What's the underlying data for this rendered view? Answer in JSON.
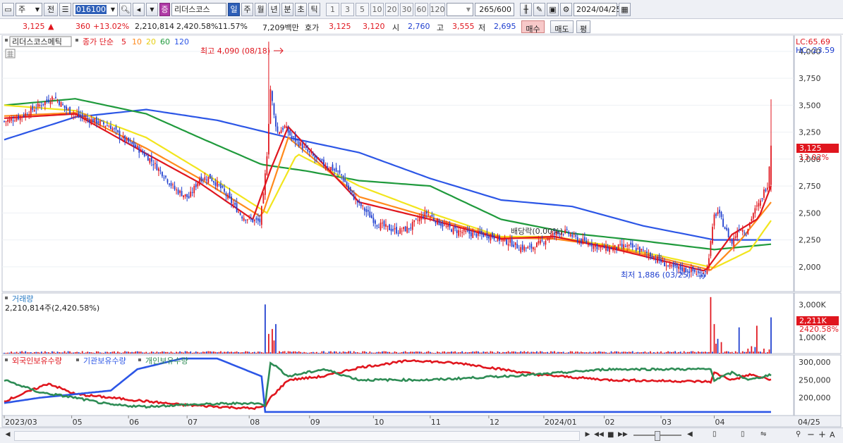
{
  "toolbar": {
    "type_label": "주",
    "prev_label": "전",
    "code": "016100",
    "name": "리더스코스",
    "periods": [
      "일",
      "주",
      "월",
      "년",
      "분",
      "초",
      "틱"
    ],
    "intervals": [
      "1",
      "3",
      "5",
      "10",
      "20",
      "30",
      "60",
      "120"
    ],
    "count": "265",
    "count_total": "/600",
    "date": "2024/04/25"
  },
  "quote": {
    "price": "3,125",
    "arrow": "▲",
    "change": "360",
    "change_pct": "+13.02%",
    "volume": "2,210,814",
    "volume_pct": "2,420.58%",
    "turnover": "11.57%",
    "amount": "7,209백만",
    "hoga_label": "호가",
    "ask": "3,125",
    "bid": "3,120",
    "open_label": "시",
    "open": "2,760",
    "high_label": "고",
    "high": "3,555",
    "low_label": "저",
    "low": "2,695",
    "buy_label": "매수",
    "sell_label": "매도",
    "eval_label": "평"
  },
  "colors": {
    "up": "#e0161e",
    "down": "#1f3fcf",
    "ma5": "#e0161e",
    "ma10": "#ff8a1c",
    "ma20": "#f2e51d",
    "ma60": "#1f9a3c",
    "ma120": "#2c56e6"
  },
  "legend": {
    "stock_name": "리더스코스메틱",
    "ma_label": "종가 단순",
    "ma_periods": [
      "5",
      "10",
      "20",
      "60",
      "120"
    ]
  },
  "price_panel": {
    "lc": "LC:65.69",
    "hc": "HC:-23.59",
    "max_label": "최고 4,090 (08/18)",
    "min_label": "최저 1,886 (03/25)",
    "dividend_label": "배당락(0.00%)",
    "current_label": "3,125",
    "current_pct": "13.02%"
  },
  "volume_panel": {
    "title": "거래량",
    "subtitle": "2,210,814주(2,420.58%)",
    "current_label": "2,211K",
    "current_pct": "2420.58%"
  },
  "holdings_panel": {
    "series_labels": [
      "외국인보유수량",
      "기관보유수량",
      "개인보유수량"
    ]
  },
  "chart_data": [
    {
      "type": "candlestick",
      "title": "리더스코스메틱",
      "ylim": [
        1770,
        4150
      ],
      "y_ticks": [
        2000,
        2250,
        2500,
        2750,
        3000,
        3250,
        3500,
        3750,
        4000
      ],
      "y_tick_labels": [
        "2,000",
        "2,250",
        "2,500",
        "2,750",
        "3,000",
        "3,250",
        "3,500",
        "3,750",
        "4,000"
      ],
      "x_tick_labels": [
        "2023/03",
        "05",
        "06",
        "07",
        "08",
        "09",
        "10",
        "11",
        "12",
        "2024/01",
        "02",
        "03",
        "04",
        "04/25"
      ],
      "annotations": {
        "high": {
          "value": 4090,
          "date": "08/18"
        },
        "low": {
          "value": 1886,
          "date": "03/25"
        },
        "last": {
          "value": 3125,
          "change_pct": 13.02
        }
      },
      "close_path": [
        [
          0,
          3350
        ],
        [
          10,
          3400
        ],
        [
          20,
          3500
        ],
        [
          28,
          3580
        ],
        [
          35,
          3460
        ],
        [
          45,
          3380
        ],
        [
          52,
          3350
        ],
        [
          60,
          3300
        ],
        [
          66,
          3200
        ],
        [
          75,
          3100
        ],
        [
          82,
          3000
        ],
        [
          90,
          2850
        ],
        [
          96,
          2720
        ],
        [
          104,
          2640
        ],
        [
          110,
          2820
        ],
        [
          116,
          2830
        ],
        [
          122,
          2730
        ],
        [
          128,
          2600
        ],
        [
          134,
          2470
        ],
        [
          140,
          2430
        ],
        [
          144,
          2420
        ],
        [
          146,
          2650
        ],
        [
          148,
          3050
        ],
        [
          150,
          3650
        ],
        [
          152,
          3400
        ],
        [
          154,
          3250
        ],
        [
          158,
          3300
        ],
        [
          162,
          3200
        ],
        [
          166,
          3150
        ],
        [
          172,
          3050
        ],
        [
          178,
          2970
        ],
        [
          184,
          2920
        ],
        [
          190,
          2850
        ],
        [
          194,
          2720
        ],
        [
          198,
          2620
        ],
        [
          204,
          2510
        ],
        [
          210,
          2400
        ],
        [
          216,
          2360
        ],
        [
          222,
          2330
        ],
        [
          228,
          2360
        ],
        [
          234,
          2450
        ],
        [
          238,
          2500
        ],
        [
          244,
          2420
        ],
        [
          250,
          2360
        ],
        [
          256,
          2330
        ],
        [
          262,
          2310
        ],
        [
          268,
          2300
        ],
        [
          274,
          2290
        ],
        [
          280,
          2250
        ],
        [
          286,
          2220
        ],
        [
          290,
          2180
        ],
        [
          296,
          2170
        ],
        [
          302,
          2220
        ],
        [
          308,
          2290
        ],
        [
          314,
          2330
        ],
        [
          318,
          2310
        ],
        [
          324,
          2240
        ],
        [
          330,
          2220
        ],
        [
          334,
          2190
        ],
        [
          340,
          2170
        ],
        [
          346,
          2180
        ],
        [
          350,
          2190
        ],
        [
          356,
          2170
        ],
        [
          360,
          2140
        ],
        [
          364,
          2110
        ],
        [
          368,
          2070
        ],
        [
          372,
          2030
        ],
        [
          376,
          1990
        ],
        [
          382,
          1980
        ],
        [
          388,
          1960
        ],
        [
          392,
          1930
        ],
        [
          396,
          1990
        ],
        [
          398,
          2220
        ],
        [
          400,
          2470
        ],
        [
          402,
          2510
        ],
        [
          406,
          2360
        ],
        [
          410,
          2220
        ],
        [
          414,
          2370
        ],
        [
          418,
          2320
        ],
        [
          422,
          2500
        ],
        [
          426,
          2600
        ],
        [
          428,
          2700
        ],
        [
          430,
          2765
        ],
        [
          432,
          3125
        ]
      ],
      "ma": {
        "5": [
          [
            0,
            3380
          ],
          [
            40,
            3420
          ],
          [
            80,
            3050
          ],
          [
            110,
            2780
          ],
          [
            140,
            2440
          ],
          [
            150,
            2900
          ],
          [
            160,
            3300
          ],
          [
            200,
            2600
          ],
          [
            240,
            2440
          ],
          [
            280,
            2260
          ],
          [
            310,
            2280
          ],
          [
            340,
            2180
          ],
          [
            370,
            2060
          ],
          [
            395,
            1960
          ],
          [
            410,
            2300
          ],
          [
            425,
            2450
          ],
          [
            432,
            2750
          ]
        ],
        "10": [
          [
            0,
            3400
          ],
          [
            40,
            3430
          ],
          [
            80,
            3100
          ],
          [
            110,
            2820
          ],
          [
            145,
            2460
          ],
          [
            160,
            3200
          ],
          [
            200,
            2650
          ],
          [
            240,
            2460
          ],
          [
            280,
            2270
          ],
          [
            310,
            2260
          ],
          [
            340,
            2190
          ],
          [
            370,
            2080
          ],
          [
            398,
            1970
          ],
          [
            415,
            2250
          ],
          [
            432,
            2600
          ]
        ],
        "20": [
          [
            0,
            3500
          ],
          [
            40,
            3450
          ],
          [
            80,
            3200
          ],
          [
            110,
            2900
          ],
          [
            148,
            2500
          ],
          [
            165,
            3050
          ],
          [
            200,
            2750
          ],
          [
            240,
            2500
          ],
          [
            280,
            2280
          ],
          [
            310,
            2280
          ],
          [
            340,
            2200
          ],
          [
            370,
            2100
          ],
          [
            400,
            1990
          ],
          [
            420,
            2150
          ],
          [
            432,
            2430
          ]
        ],
        "60": [
          [
            0,
            3500
          ],
          [
            40,
            3560
          ],
          [
            80,
            3420
          ],
          [
            110,
            3200
          ],
          [
            145,
            2950
          ],
          [
            170,
            2890
          ],
          [
            200,
            2800
          ],
          [
            240,
            2750
          ],
          [
            280,
            2440
          ],
          [
            320,
            2310
          ],
          [
            360,
            2240
          ],
          [
            400,
            2160
          ],
          [
            432,
            2210
          ]
        ],
        "120": [
          [
            0,
            3180
          ],
          [
            40,
            3390
          ],
          [
            80,
            3460
          ],
          [
            120,
            3360
          ],
          [
            160,
            3200
          ],
          [
            200,
            3060
          ],
          [
            240,
            2820
          ],
          [
            280,
            2620
          ],
          [
            320,
            2560
          ],
          [
            360,
            2380
          ],
          [
            400,
            2250
          ],
          [
            432,
            2250
          ]
        ]
      }
    },
    {
      "type": "bar",
      "title": "거래량",
      "ylim": [
        0,
        3700000
      ],
      "y_tick_labels": [
        "1,000K",
        "2,000K",
        "3,000K"
      ],
      "last": {
        "value": 2210814,
        "change_pct": 2420.58
      },
      "spikes": [
        [
          147,
          3000000
        ],
        [
          149,
          1200000
        ],
        [
          151,
          1500000
        ],
        [
          152,
          800000
        ],
        [
          153,
          1800000
        ],
        [
          398,
          3450000
        ],
        [
          400,
          1800000
        ],
        [
          401,
          600000
        ],
        [
          402,
          900000
        ],
        [
          404,
          700000
        ],
        [
          414,
          1600000
        ],
        [
          419,
          300000
        ],
        [
          421,
          450000
        ],
        [
          423,
          400000
        ],
        [
          424,
          1700000
        ],
        [
          428,
          300000
        ],
        [
          431,
          250000
        ],
        [
          432,
          2210814
        ]
      ]
    },
    {
      "type": "line",
      "title": "보유수량",
      "y_tick_labels": [
        "200,000",
        "250,000",
        "300,000"
      ],
      "series": [
        {
          "name": "외국인보유수량",
          "color": "#e0161e",
          "values": [
            [
              0,
              190000
            ],
            [
              10,
              210000
            ],
            [
              25,
              240000
            ],
            [
              40,
              210000
            ],
            [
              60,
              200000
            ],
            [
              80,
              190000
            ],
            [
              100,
              180000
            ],
            [
              140,
              170000
            ],
            [
              147,
              175000
            ],
            [
              150,
              200000
            ],
            [
              160,
              250000
            ],
            [
              180,
              260000
            ],
            [
              200,
              285000
            ],
            [
              230,
              305000
            ],
            [
              260,
              295000
            ],
            [
              300,
              265000
            ],
            [
              340,
              250000
            ],
            [
              398,
              245000
            ],
            [
              400,
              270000
            ],
            [
              410,
              250000
            ],
            [
              420,
              265000
            ],
            [
              432,
              250000
            ]
          ]
        },
        {
          "name": "기관보유수량",
          "color": "#2c56e6",
          "values": [
            [
              0,
              185000
            ],
            [
              20,
              200000
            ],
            [
              40,
              210000
            ],
            [
              60,
              220000
            ],
            [
              75,
              280000
            ],
            [
              100,
              310000
            ],
            [
              120,
              310000
            ],
            [
              145,
              260000
            ],
            [
              147,
              160000
            ],
            [
              150,
              160000
            ],
            [
              432,
              160000
            ]
          ]
        },
        {
          "name": "개인보유수량",
          "color": "#2e8c55",
          "values": [
            [
              0,
              250000
            ],
            [
              20,
              215000
            ],
            [
              40,
              200000
            ],
            [
              60,
              180000
            ],
            [
              80,
              175000
            ],
            [
              100,
              180000
            ],
            [
              140,
              185000
            ],
            [
              147,
              180000
            ],
            [
              150,
              300000
            ],
            [
              160,
              260000
            ],
            [
              180,
              280000
            ],
            [
              200,
              250000
            ],
            [
              240,
              250000
            ],
            [
              300,
              265000
            ],
            [
              340,
              280000
            ],
            [
              398,
              280000
            ],
            [
              400,
              250000
            ],
            [
              410,
              270000
            ],
            [
              420,
              250000
            ],
            [
              432,
              265000
            ]
          ]
        }
      ]
    }
  ]
}
